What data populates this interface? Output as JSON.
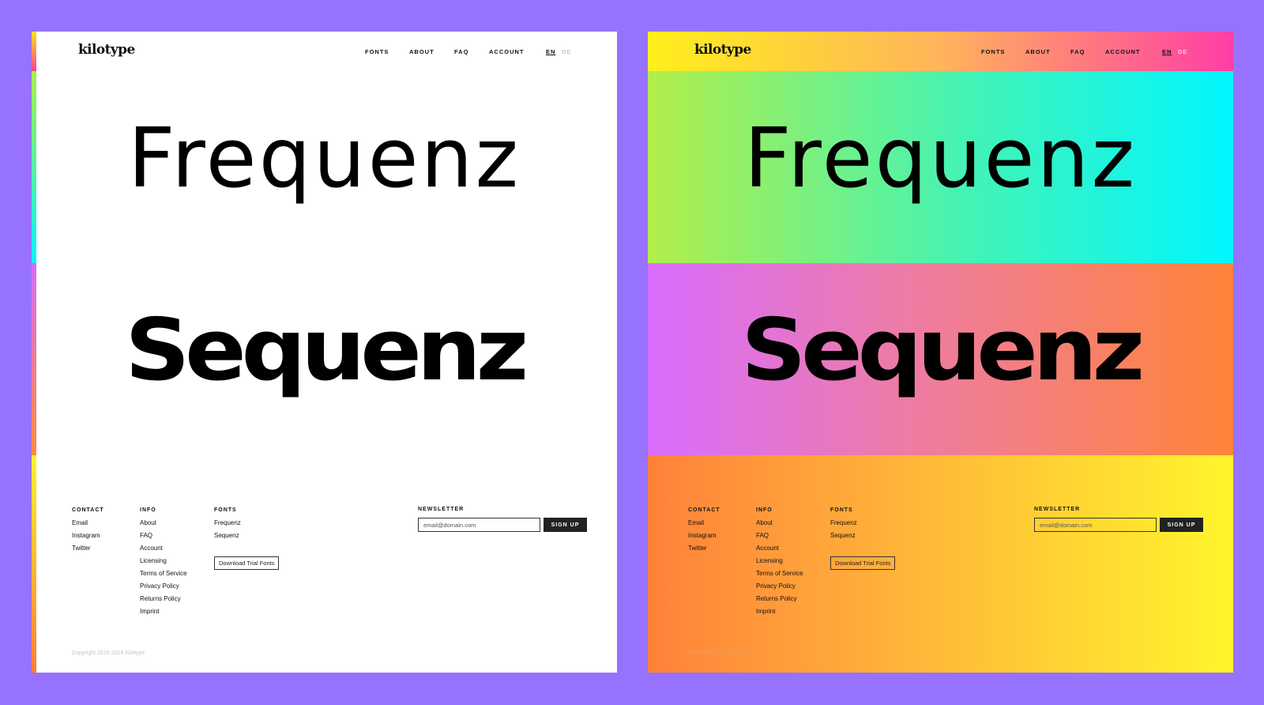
{
  "background_color": "#9672FF",
  "logo": "kilotype",
  "nav": {
    "fonts": "FONTS",
    "about": "ABOUT",
    "faq": "FAQ",
    "account": "ACCOUNT",
    "lang_en": "EN",
    "lang_de": "DE"
  },
  "specimens": {
    "font_a": "Frequenz",
    "font_b": "Sequenz"
  },
  "footer": {
    "contact": {
      "heading": "CONTACT",
      "links": [
        "Email",
        "Instagram",
        "Twitter"
      ]
    },
    "info": {
      "heading": "INFO",
      "links": [
        "About",
        "FAQ",
        "Account",
        "Licensing",
        "Terms of Service",
        "Privacy Policy",
        "Returns Policy",
        "Imprint"
      ]
    },
    "fonts": {
      "heading": "FONTS",
      "links": [
        "Frequenz",
        "Sequenz"
      ],
      "trial_button": "Download Trial Fonts"
    },
    "newsletter": {
      "heading": "NEWSLETTER",
      "placeholder": "email@domain.com",
      "button": "SIGN UP"
    },
    "copyright": "Copyright 2015-2018 Kilotype"
  },
  "gradients": {
    "header": [
      "#FFEF1C",
      "#FFB45A",
      "#FF3DA6"
    ],
    "hero_a": [
      "#B2EE49",
      "#43F3B6",
      "#00F6FF"
    ],
    "hero_b": [
      "#D86DFF",
      "#EE7CA3",
      "#FF8439"
    ],
    "footer": [
      "#FF813A",
      "#FFB03A",
      "#FFF52C"
    ]
  }
}
